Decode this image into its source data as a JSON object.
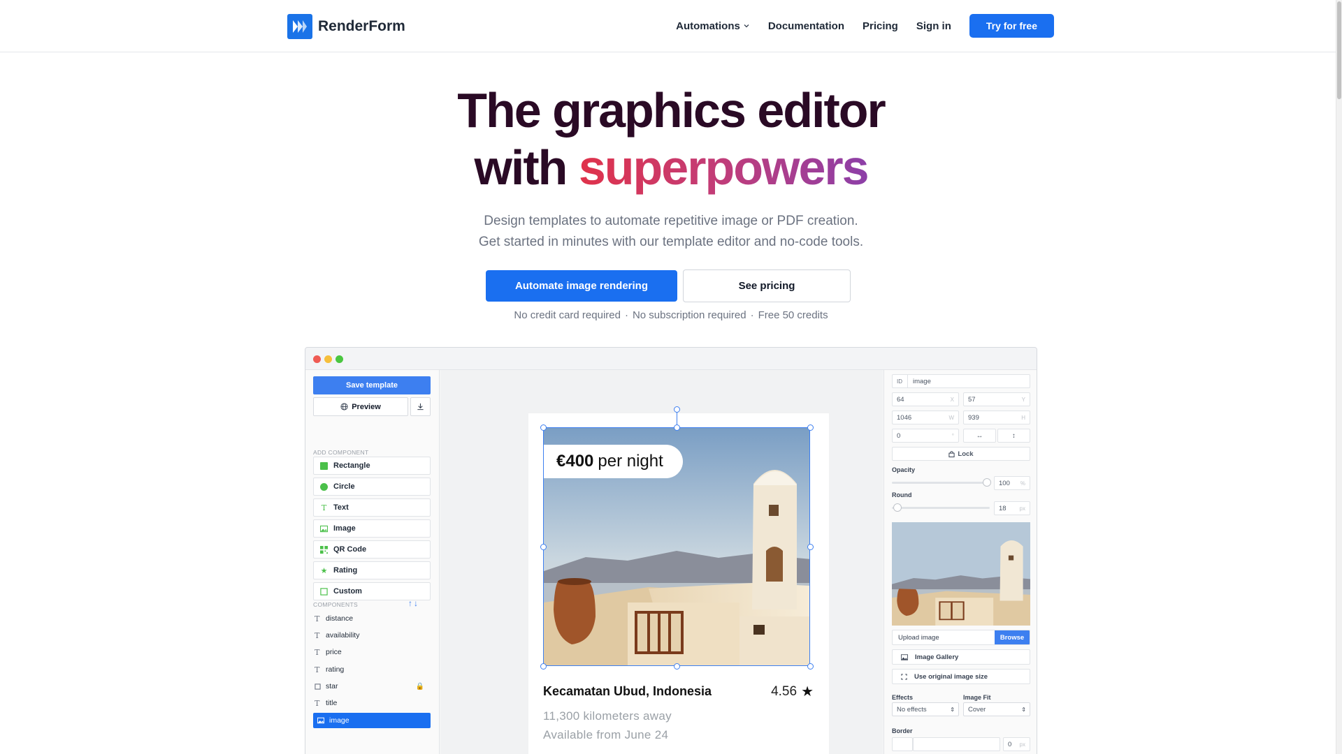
{
  "nav": {
    "brand": "RenderForm",
    "links": [
      "Automations",
      "Documentation",
      "Pricing",
      "Sign in"
    ],
    "cta": "Try for free"
  },
  "hero": {
    "title_line1": "The graphics editor",
    "title_line2_plain": "with",
    "title_line2_gradient": "superpowers",
    "subtitle_line1": "Design templates to automate repetitive image or PDF creation.",
    "subtitle_line2": "Get started in minutes with our template editor and no-code tools.",
    "primary_button": "Automate image rendering",
    "secondary_button": "See pricing",
    "notes": [
      "No credit card required",
      "No subscription required",
      "Free 50 credits"
    ]
  },
  "editor": {
    "left": {
      "save_button": "Save template",
      "preview_button": "Preview",
      "add_component_label": "ADD COMPONENT",
      "components": [
        {
          "label": "Rectangle",
          "icon": "rectangle-icon"
        },
        {
          "label": "Circle",
          "icon": "circle-icon"
        },
        {
          "label": "Text",
          "icon": "text-icon"
        },
        {
          "label": "Image",
          "icon": "image-icon"
        },
        {
          "label": "QR Code",
          "icon": "qr-code-icon"
        },
        {
          "label": "Rating",
          "icon": "star-icon"
        },
        {
          "label": "Custom",
          "icon": "custom-icon"
        }
      ],
      "components_label": "COMPONENTS",
      "layers": [
        "distance",
        "availability",
        "price",
        "rating",
        "star",
        "title",
        "image"
      ]
    },
    "card": {
      "price_bold": "€400",
      "price_rest": "per night",
      "title": "Kecamatan Ubud, Indonesia",
      "rating": "4.56",
      "distance": "11,300 kilometers away",
      "availability": "Available from June 24"
    },
    "right": {
      "id_prefix": "ID",
      "id_value": "image",
      "x": "64",
      "x_label": "X",
      "y": "57",
      "y_label": "Y",
      "w": "1046",
      "w_label": "W",
      "h": "939",
      "h_label": "H",
      "rotation": "0",
      "rotation_label": "°",
      "lock_label": "Lock",
      "opacity_label": "Opacity",
      "opacity_value": "100",
      "opacity_unit": "%",
      "opacity_level": 1.0,
      "round_label": "Round",
      "round_value": "18",
      "round_unit": "px",
      "round_level": 0.05,
      "upload_label": "Upload image",
      "browse_label": "Browse",
      "gallery_label": "Image Gallery",
      "original_size_label": "Use original image size",
      "effects_label": "Effects",
      "effects_value": "No effects",
      "fit_label": "Image Fit",
      "fit_value": "Cover",
      "border_label": "Border",
      "border_value": "0",
      "border_unit": "px"
    }
  }
}
